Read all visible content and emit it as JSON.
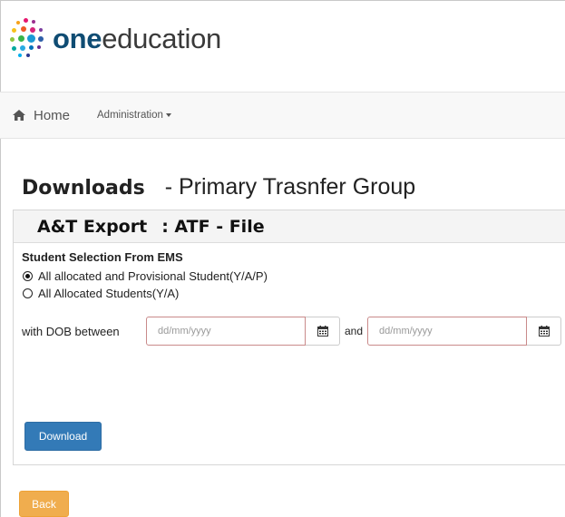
{
  "brand": {
    "bold": "one",
    "rest": "education"
  },
  "nav": {
    "home": "Home",
    "administration": "Administration"
  },
  "page": {
    "title": "Downloads",
    "subtitle": "- Primary Trasnfer Group"
  },
  "panel": {
    "heading": "A&T Export",
    "heading_suffix": ": ATF - File",
    "selection_title": "Student Selection From EMS",
    "options": [
      {
        "label": "All allocated and Provisional Student(Y/A/P)",
        "checked": true
      },
      {
        "label": "All Allocated Students(Y/A)",
        "checked": false
      }
    ],
    "dob_label": "with DOB between",
    "from_placeholder": "dd/mm/yyyy",
    "and_label": "and",
    "to_placeholder": "dd/mm/yyyy",
    "download_label": "Download"
  },
  "back_label": "Back",
  "colors": {
    "primary": "#337ab7",
    "warning": "#f0ad4e",
    "brand": "#0f4c73"
  },
  "icons": [
    "home-icon",
    "calendar-icon",
    "caret-down-icon",
    "logo-dots-icon"
  ]
}
